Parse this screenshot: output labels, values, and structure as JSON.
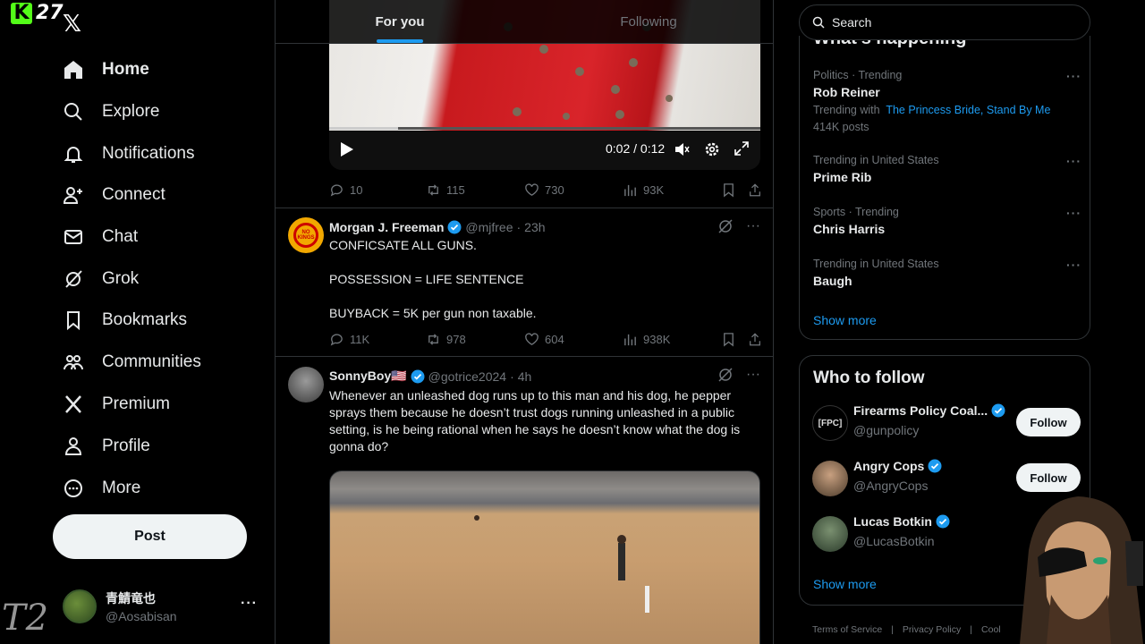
{
  "overlay": {
    "stream_number": "27",
    "signature": "T2"
  },
  "nav": {
    "items": [
      {
        "label": "Home"
      },
      {
        "label": "Explore"
      },
      {
        "label": "Notifications"
      },
      {
        "label": "Connect"
      },
      {
        "label": "Chat"
      },
      {
        "label": "Grok"
      },
      {
        "label": "Bookmarks"
      },
      {
        "label": "Communities"
      },
      {
        "label": "Premium"
      },
      {
        "label": "Profile"
      },
      {
        "label": "More"
      }
    ],
    "post_label": "Post",
    "account": {
      "display_name": "青鯖竜也",
      "handle": "@Aosabisan"
    }
  },
  "tabs": [
    {
      "label": "For you"
    },
    {
      "label": "Following"
    }
  ],
  "video1": {
    "time": "0:02 / 0:12",
    "progress": 0.16
  },
  "tweet0": {
    "replies": "10",
    "reposts": "115",
    "likes": "730",
    "views": "93K"
  },
  "tweet1": {
    "name": "Morgan J. Freeman",
    "handle": "@mjfree",
    "time": "23h",
    "avatar_text": "NO KINGS",
    "text": "CONFICSATE ALL GUNS.\n\nPOSSESSION = LIFE SENTENCE\n\nBUYBACK = 5K per gun non taxable.",
    "replies": "11K",
    "reposts": "978",
    "likes": "604",
    "views": "938K"
  },
  "tweet2": {
    "name": "SonnyBoy🇺🇸",
    "handle": "@gotrice2024",
    "time": "4h",
    "text": "Whenever an unleashed dog runs up to this man and his dog, he pepper sprays them because he doesn’t trust dogs running unleashed in a public setting, is he being rational when he says he doesn’t know what the dog is gonna do?"
  },
  "search": {
    "placeholder": "Search"
  },
  "trends": {
    "heading": "What’s happening",
    "items": [
      {
        "category": "Politics · Trending",
        "name": "Rob Reiner",
        "with_prefix": "Trending with",
        "with_links": "The Princess Bride, Stand By Me",
        "posts": "414K posts"
      },
      {
        "category": "Trending in United States",
        "name": "Prime Rib"
      },
      {
        "category": "Sports · Trending",
        "name": "Chris Harris"
      },
      {
        "category": "Trending in United States",
        "name": "Baugh"
      }
    ],
    "show_more": "Show more"
  },
  "who_to_follow": {
    "heading": "Who to follow",
    "items": [
      {
        "name": "Firearms Policy Coal...",
        "handle": "@gunpolicy",
        "button": "Follow",
        "avatar_text": "[FPC]"
      },
      {
        "name": "Angry Cops",
        "handle": "@AngryCops",
        "button": "Follow"
      },
      {
        "name": "Lucas Botkin",
        "handle": "@LucasBotkin"
      }
    ],
    "show_more": "Show more"
  },
  "footer": {
    "links": [
      "Terms of Service",
      "|",
      "Privacy Policy",
      "|",
      "Cool"
    ]
  },
  "colors": {
    "accent": "#1d9bf0",
    "verified": "#1d9bf0",
    "kick_green": "#53fc18"
  }
}
